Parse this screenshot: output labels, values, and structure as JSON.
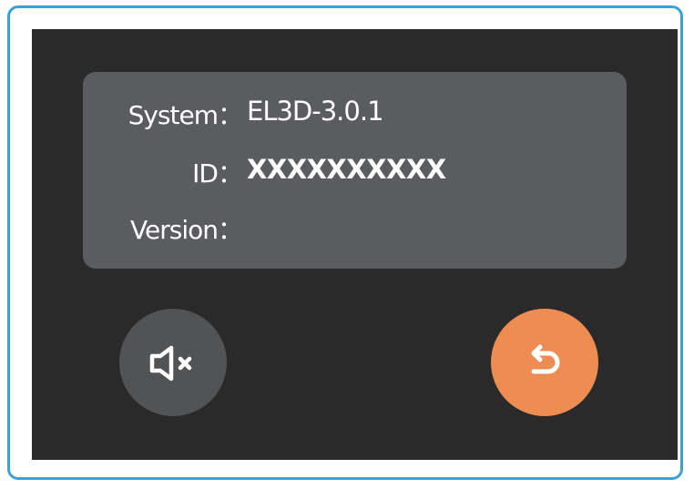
{
  "info": {
    "system_label": "System：",
    "system_value": "EL3D-3.0.1",
    "id_label": "ID：",
    "id_value": "XXXXXXXXXX",
    "version_label": "Version：",
    "version_value": ""
  },
  "buttons": {
    "mute_icon": "speaker-mute-icon",
    "back_icon": "return-arrow-icon"
  },
  "colors": {
    "frame_border": "#3aa0d6",
    "screen_bg": "#2a2a2a",
    "panel_bg": "#5b5c60",
    "mute_button_bg": "#525355",
    "back_button_bg": "#ee8d52"
  }
}
